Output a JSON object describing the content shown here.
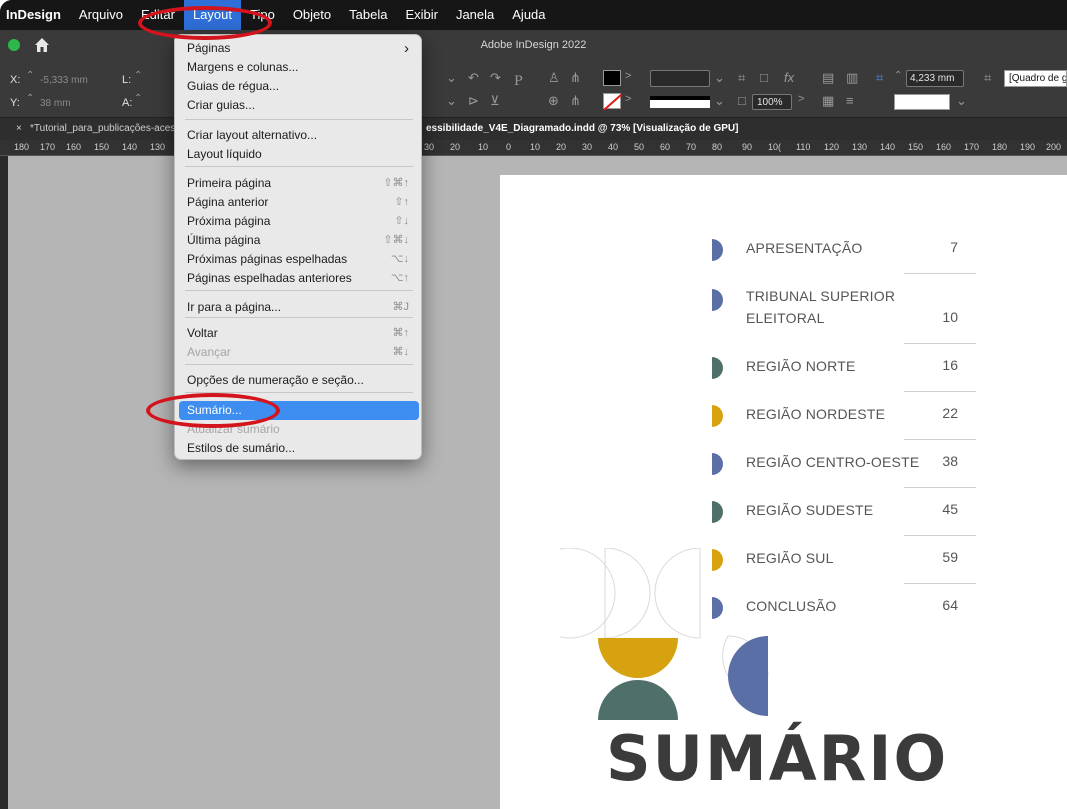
{
  "menubar": {
    "app": "InDesign",
    "items": [
      "Arquivo",
      "Editar",
      "Layout",
      "Tipo",
      "Objeto",
      "Tabela",
      "Exibir",
      "Janela",
      "Ajuda"
    ]
  },
  "window": {
    "title": "Adobe InDesign 2022"
  },
  "control_panel": {
    "x_label": "X:",
    "x_value": "-5,333 mm",
    "y_label": "Y:",
    "y_value": "38 mm",
    "l_label": "L:",
    "a_label": "A:",
    "zoom_value": "100%",
    "spacing_value": "4,233 mm",
    "frame_type": "[Quadro de g"
  },
  "document_tabs": {
    "left": "*Tutorial_para_publicações-aces",
    "right": "essibilidade_V4E_Diagramado.indd @ 73% [Visualização de GPU]"
  },
  "ruler": {
    "ticks_left": [
      "180",
      "170",
      "160",
      "150",
      "140",
      "130"
    ],
    "ticks_right": [
      "30",
      "20",
      "10",
      "0",
      "10",
      "20",
      "30",
      "40",
      "50",
      "60",
      "70",
      "80",
      "90",
      "10(",
      "110",
      "120",
      "130",
      "140",
      "150",
      "160",
      "170",
      "180",
      "190",
      "200"
    ]
  },
  "layout_menu": {
    "items": [
      {
        "label": "Páginas",
        "shortcut": "›",
        "state": "normal"
      },
      {
        "label": "Margens e colunas...",
        "shortcut": "",
        "state": "normal"
      },
      {
        "label": "Guias de régua...",
        "shortcut": "",
        "state": "normal"
      },
      {
        "label": "Criar guias...",
        "shortcut": "",
        "state": "normal"
      },
      {
        "label": "Criar layout alternativo...",
        "shortcut": "",
        "state": "normal"
      },
      {
        "label": "Layout líquido",
        "shortcut": "",
        "state": "normal"
      },
      {
        "label": "Primeira página",
        "shortcut": "⇧⌘↑",
        "state": "normal"
      },
      {
        "label": "Página anterior",
        "shortcut": "⇧↑",
        "state": "normal"
      },
      {
        "label": "Próxima página",
        "shortcut": "⇧↓",
        "state": "normal"
      },
      {
        "label": "Última página",
        "shortcut": "⇧⌘↓",
        "state": "normal"
      },
      {
        "label": "Próximas páginas espelhadas",
        "shortcut": "⌥↓",
        "state": "normal"
      },
      {
        "label": "Páginas espelhadas anteriores",
        "shortcut": "⌥↑",
        "state": "normal"
      },
      {
        "label": "Ir para a página...",
        "shortcut": "⌘J",
        "state": "normal"
      },
      {
        "label": "Voltar",
        "shortcut": "⌘↑",
        "state": "normal"
      },
      {
        "label": "Avançar",
        "shortcut": "⌘↓",
        "state": "disabled"
      },
      {
        "label": "Opções de numeração e seção...",
        "shortcut": "",
        "state": "normal"
      },
      {
        "label": "Sumário...",
        "shortcut": "",
        "state": "selected"
      },
      {
        "label": "Atualizar sumário",
        "shortcut": "",
        "state": "disabled"
      },
      {
        "label": "Estilos de sumário...",
        "shortcut": "",
        "state": "normal"
      }
    ]
  },
  "toc": {
    "entries": [
      {
        "title": "APRESENTAÇÃO",
        "page": "7",
        "color": "#5a6fa5"
      },
      {
        "title": "TRIBUNAL SUPERIOR",
        "title2": "ELEITORAL",
        "page": "10",
        "color": "#5a6fa5"
      },
      {
        "title": "REGIÃO NORTE",
        "page": "16",
        "color": "#4f6f6a"
      },
      {
        "title": "REGIÃO NORDESTE",
        "page": "22",
        "color": "#d6a20f"
      },
      {
        "title": "REGIÃO CENTRO-OESTE",
        "page": "38",
        "color": "#5a6fa5"
      },
      {
        "title": "REGIÃO SUDESTE",
        "page": "45",
        "color": "#4f6f6a"
      },
      {
        "title": "REGIÃO SUL",
        "page": "59",
        "color": "#d6a20f"
      },
      {
        "title": "CONCLUSÃO",
        "page": "64",
        "color": "#5a6fa5"
      }
    ],
    "heading": "SUMÁRIO"
  },
  "colors": {
    "highlight": "#d3141d",
    "blue": "#5a6fa5",
    "teal": "#4f6f6a",
    "yellow": "#d6a20f",
    "menu_selected": "#3d8ef0"
  }
}
